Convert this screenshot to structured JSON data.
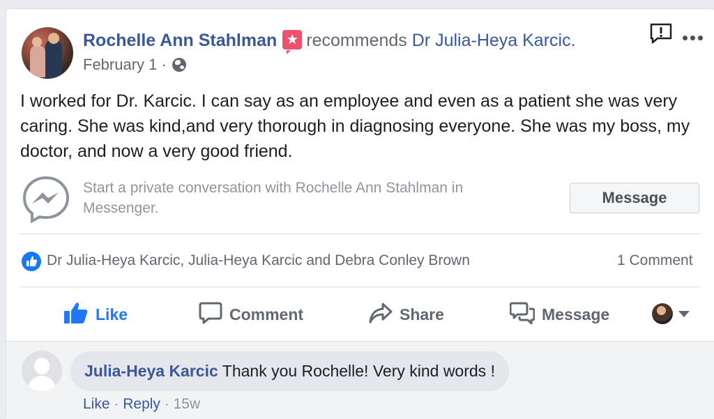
{
  "post": {
    "author": "Rochelle Ann Stahlman",
    "recommends_text": "recommends",
    "page_name": "Dr Julia-Heya Karcic.",
    "date": "February 1",
    "date_separator": "·",
    "body": "I worked for Dr. Karcic. I can say as an employee and even as a patient she was very caring. She was kind,and very thorough in diagnosing everyone. She was my boss, my doctor, and now a very good friend."
  },
  "messenger_prompt": {
    "text": "Start a private conversation with Rochelle Ann Stahlman in Messenger.",
    "button_label": "Message"
  },
  "reactions": {
    "likers": "Dr Julia-Heya Karcic, Julia-Heya Karcic and Debra Conley Brown",
    "comment_count": "1 Comment"
  },
  "actions": {
    "like": "Like",
    "comment": "Comment",
    "share": "Share",
    "message": "Message"
  },
  "comment": {
    "author": "Julia-Heya Karcic",
    "text": "Thank you Rochelle! Very kind words !",
    "like_label": "Like",
    "reply_label": "Reply",
    "separator": "·",
    "age": "15w"
  },
  "icons": {
    "recommend": "recommend-star-icon",
    "privacy": "globe-icon",
    "report": "report-icon",
    "more": "more-options-icon",
    "messenger": "messenger-icon"
  },
  "colors": {
    "link": "#385898",
    "like_blue": "#2078f4",
    "recommend_badge": "#f0506e",
    "muted": "#606770"
  }
}
